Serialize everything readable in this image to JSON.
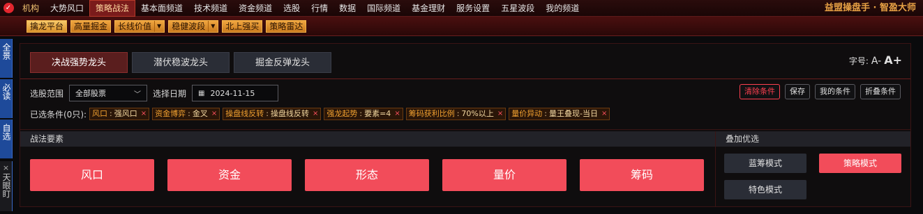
{
  "topbar": {
    "menu": [
      "机构",
      "大势风口",
      "策略战法",
      "基本面频道",
      "技术频道",
      "资金频道",
      "选股",
      "行情",
      "数据",
      "国际频道",
      "基金理财",
      "服务设置",
      "五星波段",
      "我的频道"
    ],
    "active_index": 2,
    "brand": "益盟操盘手 · 智盈大师"
  },
  "subbar": {
    "items": [
      {
        "label": "擒龙平台",
        "dropdown": false
      },
      {
        "label": "高量掘金",
        "dropdown": false
      },
      {
        "label": "长线价值",
        "dropdown": true
      },
      {
        "label": "稳健波段",
        "dropdown": true
      },
      {
        "label": "北上强买",
        "dropdown": false
      },
      {
        "label": "策略雷达",
        "dropdown": false
      }
    ]
  },
  "sidetabs": [
    {
      "label": "全景"
    },
    {
      "label": "必读"
    },
    {
      "label": "自选"
    },
    {
      "label": "天眼盯",
      "close": "×"
    }
  ],
  "tabs": [
    "决战强势龙头",
    "潜伏稳波龙头",
    "掘金反弹龙头"
  ],
  "fontsize": {
    "label": "字号:",
    "small": "A-",
    "big": "A+"
  },
  "filter": {
    "range_label": "选股范围",
    "range_value": "全部股票",
    "date_label": "选择日期",
    "date_value": "2024-11-15",
    "selected_label": "已选条件(0只):",
    "actions": [
      "清除条件",
      "保存",
      "我的条件",
      "折叠条件"
    ],
    "chips": [
      {
        "key": "风口",
        "value": "强风口"
      },
      {
        "key": "资金博弈",
        "value": "金叉"
      },
      {
        "key": "操盘线反转",
        "value": "操盘线反转"
      },
      {
        "key": "强龙起势",
        "value": "要素=4"
      },
      {
        "key": "筹码获利比例",
        "value": "70%以上"
      },
      {
        "key": "量价异动",
        "value": "量王叠现-当日"
      }
    ]
  },
  "left_panel": {
    "title": "战法要素",
    "buttons": [
      "风口",
      "资金",
      "形态",
      "量价",
      "筹码"
    ]
  },
  "right_panel": {
    "title": "叠加优选",
    "modes": [
      {
        "label": "蓝筹模式",
        "active": false
      },
      {
        "label": "策略模式",
        "active": true
      },
      {
        "label": "特色模式",
        "active": false
      }
    ]
  },
  "icons": {
    "calendar": "calendar-icon",
    "chevron": "chevron-down-icon",
    "close": "close-icon"
  },
  "colors": {
    "accent_red": "#f24c5a",
    "tab_active": "#5a1e1e",
    "brand_orange": "#e9a245",
    "chip_key": "#f0a030"
  }
}
